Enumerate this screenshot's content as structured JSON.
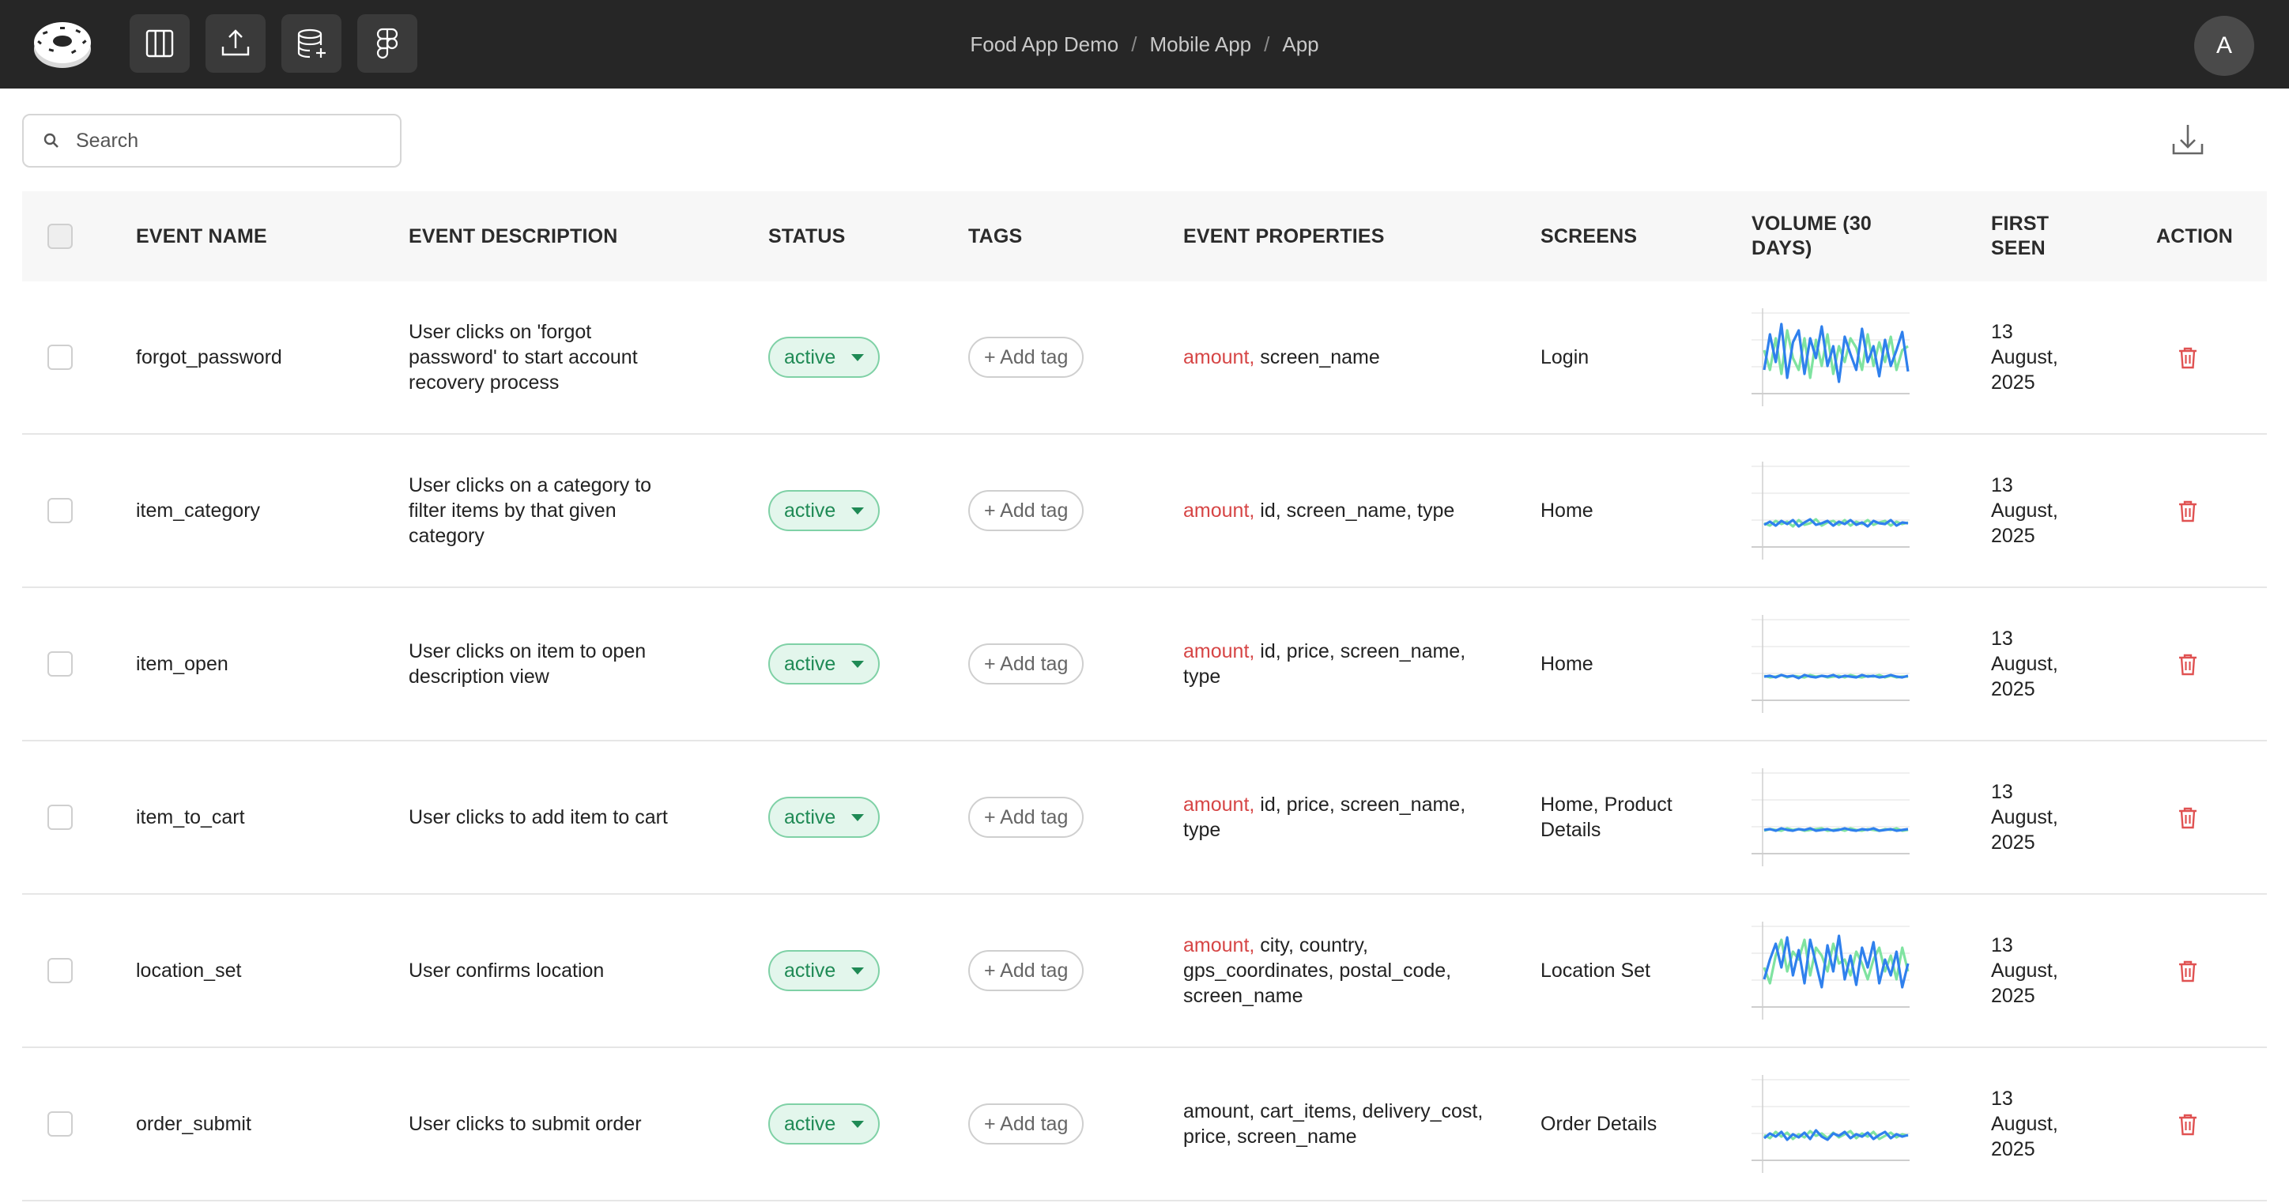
{
  "header": {
    "breadcrumb": [
      "Food App Demo",
      "Mobile App",
      "App"
    ],
    "avatar_initial": "A",
    "tools": [
      "columns-icon",
      "upload-icon",
      "database-add-icon",
      "figma-icon"
    ]
  },
  "toolbar": {
    "search_placeholder": "Search",
    "download_icon": "download-icon"
  },
  "table": {
    "columns": [
      "EVENT NAME",
      "EVENT DESCRIPTION",
      "STATUS",
      "TAGS",
      "EVENT PROPERTIES",
      "SCREENS",
      "VOLUME (30 DAYS)",
      "FIRST SEEN",
      "ACTION"
    ],
    "rows": [
      {
        "name": "forgot_password",
        "description": "User clicks on 'forgot password' to start account recovery process",
        "status": "active",
        "tag_label": "+ Add tag",
        "props_highlight": "amount,",
        "props_rest": "screen_name",
        "screens": "Login",
        "first_seen": "13 August, 2025",
        "volume_blue": [
          30,
          75,
          40,
          88,
          20,
          65,
          80,
          25,
          70,
          45,
          85,
          35,
          60,
          15,
          72,
          50,
          30,
          82,
          40,
          60,
          22,
          68,
          35,
          55,
          78,
          28
        ],
        "volume_green": [
          55,
          30,
          70,
          25,
          80,
          45,
          30,
          70,
          20,
          68,
          35,
          75,
          25,
          60,
          40,
          70,
          58,
          30,
          75,
          35,
          65,
          40,
          72,
          30,
          55,
          60
        ]
      },
      {
        "name": "item_category",
        "description": "User clicks on a category to filter items by that given category",
        "status": "active",
        "tag_label": "+ Add tag",
        "props_highlight": "amount,",
        "props_rest": "id, screen_name, type",
        "screens": "Home",
        "first_seen": "13 August, 2025",
        "volume_blue": [
          28,
          32,
          27,
          33,
          29,
          34,
          26,
          31,
          35,
          28,
          30,
          33,
          27,
          32,
          29,
          34,
          28,
          31,
          26,
          33,
          30,
          29,
          34,
          27,
          31,
          30
        ],
        "volume_green": [
          30,
          27,
          33,
          29,
          32,
          26,
          34,
          28,
          30,
          35,
          27,
          31,
          33,
          28,
          34,
          27,
          32,
          29,
          34,
          28,
          31,
          33,
          27,
          32,
          29,
          31
        ]
      },
      {
        "name": "item_open",
        "description": "User clicks on item to open description view",
        "status": "active",
        "tag_label": "+ Add tag",
        "props_highlight": "amount,",
        "props_rest": "id, price, screen_name, type",
        "screens": "Home",
        "first_seen": "13 August, 2025",
        "volume_blue": [
          30,
          31,
          29,
          32,
          30,
          31,
          28,
          32,
          30,
          29,
          31,
          30,
          32,
          29,
          31,
          30,
          29,
          32,
          30,
          31,
          29,
          30,
          32,
          30,
          29,
          31
        ],
        "volume_green": [
          31,
          29,
          30,
          32,
          29,
          31,
          30,
          29,
          32,
          30,
          31,
          29,
          30,
          31,
          29,
          32,
          30,
          29,
          31,
          30,
          32,
          29,
          31,
          29,
          30,
          30
        ]
      },
      {
        "name": "item_to_cart",
        "description": "User clicks to add item to cart",
        "status": "active",
        "tag_label": "+ Add tag",
        "props_highlight": "amount,",
        "props_rest": "id, price, screen_name, type",
        "screens": "Home, Product Details",
        "first_seen": "13 August, 2025",
        "volume_blue": [
          30,
          31,
          29,
          32,
          30,
          29,
          31,
          30,
          32,
          29,
          30,
          31,
          29,
          30,
          32,
          30,
          29,
          31,
          30,
          32,
          29,
          30,
          31,
          29,
          30,
          31
        ],
        "volume_green": [
          29,
          31,
          30,
          29,
          32,
          30,
          31,
          29,
          30,
          31,
          32,
          29,
          30,
          31,
          29,
          32,
          30,
          29,
          31,
          30,
          29,
          31,
          30,
          32,
          29,
          30
        ]
      },
      {
        "name": "location_set",
        "description": "User confirms location",
        "status": "active",
        "tag_label": "+ Add tag",
        "props_highlight": "amount,",
        "props_rest": "city, country, gps_coordinates, postal_code, screen_name",
        "screens": "Location Set",
        "first_seen": "13 August, 2025",
        "volume_blue": [
          35,
          60,
          80,
          50,
          88,
          40,
          72,
          30,
          85,
          55,
          25,
          78,
          45,
          90,
          35,
          65,
          28,
          75,
          50,
          82,
          30,
          60,
          40,
          70,
          25,
          55
        ],
        "volume_green": [
          50,
          30,
          65,
          85,
          45,
          70,
          60,
          85,
          40,
          75,
          65,
          45,
          80,
          55,
          60,
          40,
          70,
          55,
          35,
          60,
          75,
          45,
          65,
          35,
          75,
          45
        ]
      },
      {
        "name": "order_submit",
        "description": "User clicks to submit order",
        "status": "active",
        "tag_label": "+ Add tag",
        "props_highlight": "",
        "props_rest": "amount, cart_items, delivery_cost, price, screen_name",
        "screens": "Order Details",
        "first_seen": "13 August, 2025",
        "volume_blue": [
          28,
          34,
          30,
          36,
          26,
          33,
          29,
          35,
          27,
          38,
          30,
          26,
          34,
          31,
          36,
          28,
          33,
          30,
          35,
          27,
          32,
          36,
          28,
          33,
          30,
          32
        ],
        "volume_green": [
          32,
          28,
          36,
          30,
          35,
          27,
          33,
          29,
          37,
          31,
          34,
          28,
          35,
          29,
          33,
          37,
          28,
          34,
          30,
          36,
          27,
          31,
          35,
          29,
          33,
          31
        ]
      }
    ]
  },
  "colors": {
    "topbar": "#262626",
    "status_green": "#1f8a55",
    "status_bg": "#e3f6ec",
    "property_highlight": "#d64545",
    "trash_red": "#e05252",
    "spark_blue": "#2f80ed",
    "spark_green": "#7fe3a0"
  }
}
